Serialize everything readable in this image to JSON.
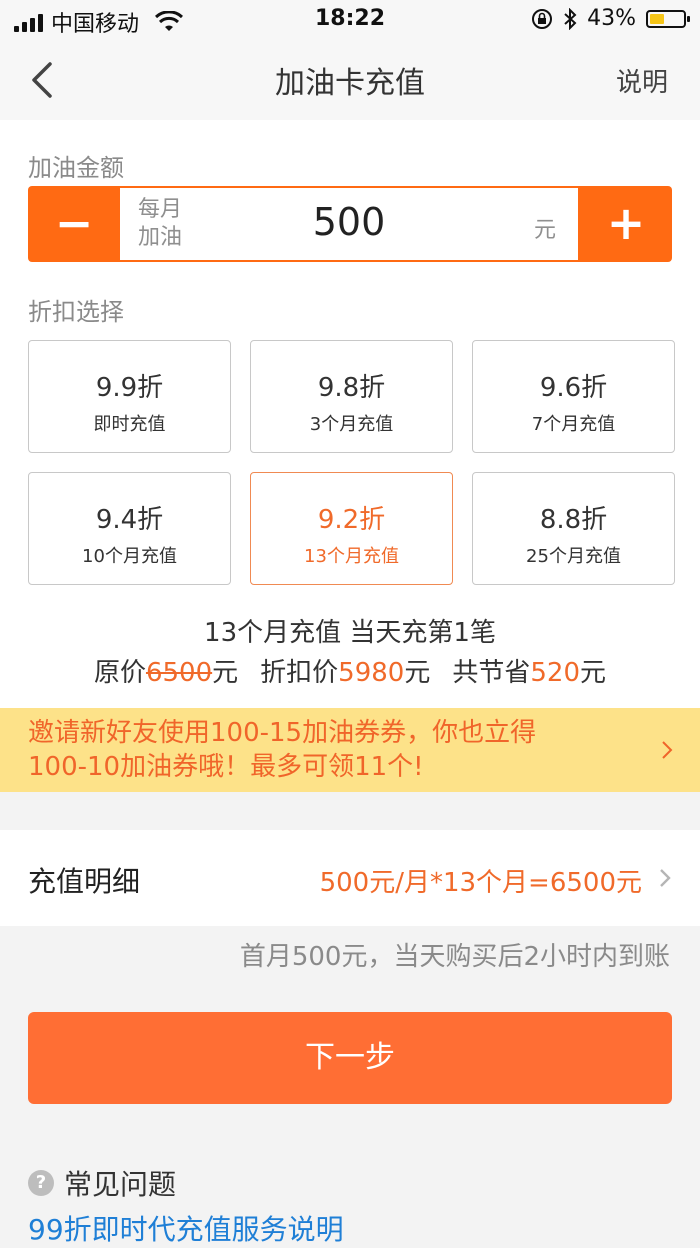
{
  "status_bar": {
    "carrier": "中国移动",
    "time": "18:22",
    "battery": "43%",
    "battery_level": 0.43,
    "battery_color": "#f5c518"
  },
  "nav": {
    "title": "加油卡充值",
    "right_link": "说明",
    "back_icon": "chevron-left-icon"
  },
  "amount": {
    "label": "加油金额",
    "prefix_line1": "每月",
    "prefix_line2": "加油",
    "value": "500",
    "unit": "元",
    "minus": "−",
    "plus": "+",
    "accent": "#ff6a13"
  },
  "discount": {
    "label": "折扣选择",
    "options": [
      {
        "rate": "9.9折",
        "desc": "即时充值"
      },
      {
        "rate": "9.8折",
        "desc": "3个月充值"
      },
      {
        "rate": "9.6折",
        "desc": "7个月充值"
      },
      {
        "rate": "9.4折",
        "desc": "10个月充值"
      },
      {
        "rate": "9.2折",
        "desc": "13个月充值"
      },
      {
        "rate": "8.8折",
        "desc": "25个月充值"
      }
    ],
    "selected_index": 4
  },
  "summary": {
    "line1": "13个月充值 当天充第1笔",
    "orig_label": "原价",
    "orig_value": "6500",
    "yuan": "元",
    "disc_label": "折扣价",
    "disc_value": "5980",
    "save_label": "共节省",
    "save_value": "520"
  },
  "banner": {
    "text_line1": "邀请新好友使用100-15加油券券，你也立得",
    "text_line2": "100-10加油券哦！最多可领11个!",
    "bg": "#fde289"
  },
  "detail": {
    "label": "充值明细",
    "value": "500元/月*13个月=6500元"
  },
  "note": "首月500元，当天购买后2小时内到账",
  "next_button": "下一步",
  "faq": {
    "icon": "?",
    "title": "常见问题",
    "link": "99折即时代充值服务说明"
  }
}
